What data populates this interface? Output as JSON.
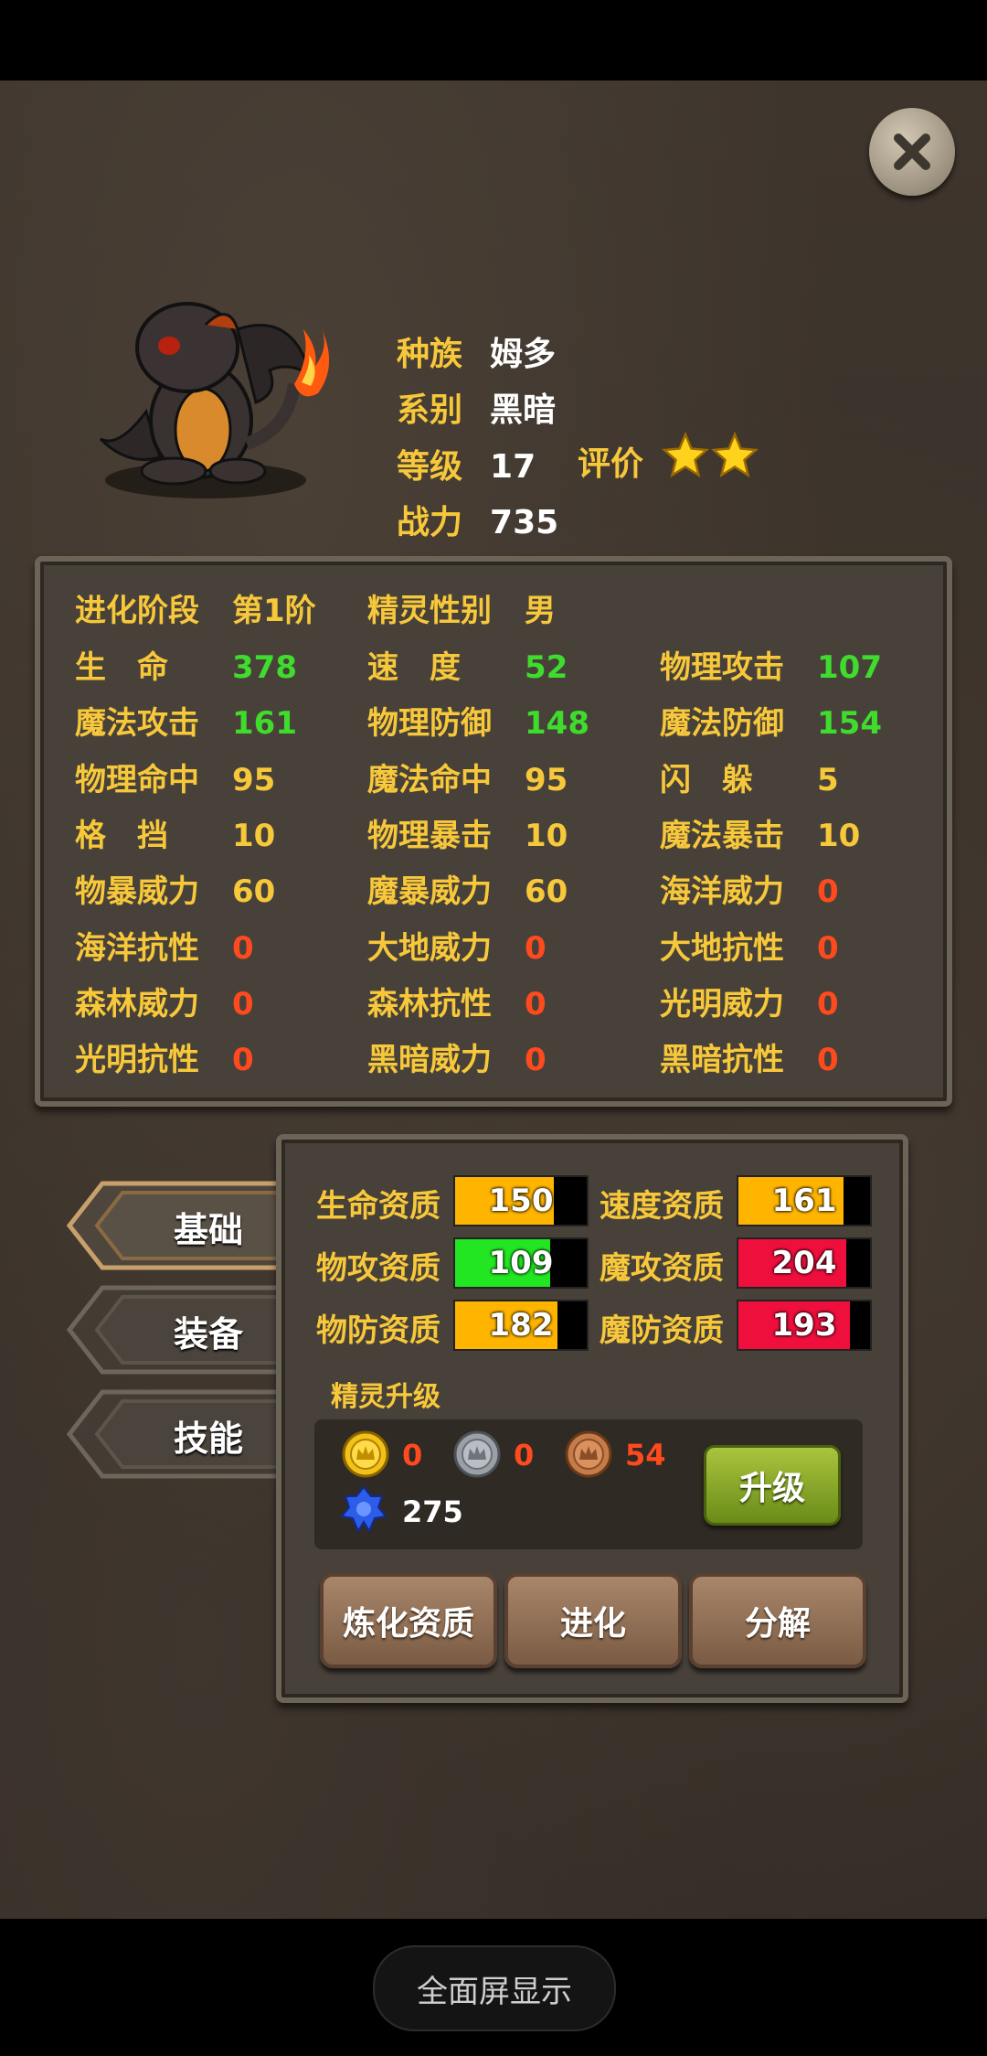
{
  "profile": {
    "race_label": "种族",
    "race": "姆多",
    "type_label": "系别",
    "type": "黑暗",
    "level_label": "等级",
    "level": "17",
    "power_label": "战力",
    "power": "735",
    "rating_label": "评价",
    "rating_stars": 2
  },
  "stats": {
    "header": [
      {
        "label": "进化阶段",
        "value": "第1阶",
        "color": "#f7c83a"
      },
      {
        "label": "精灵性别",
        "value": "男",
        "color": "#f7c83a"
      }
    ],
    "rows": [
      [
        {
          "label": "生　命",
          "value": "378",
          "color": "#3fdc2e"
        },
        {
          "label": "速　度",
          "value": "52",
          "color": "#3fdc2e"
        },
        {
          "label": "物理攻击",
          "value": "107",
          "color": "#3fdc2e"
        }
      ],
      [
        {
          "label": "魔法攻击",
          "value": "161",
          "color": "#3fdc2e"
        },
        {
          "label": "物理防御",
          "value": "148",
          "color": "#3fdc2e"
        },
        {
          "label": "魔法防御",
          "value": "154",
          "color": "#3fdc2e"
        }
      ],
      [
        {
          "label": "物理命中",
          "value": "95",
          "color": "#f7c83a"
        },
        {
          "label": "魔法命中",
          "value": "95",
          "color": "#f7c83a"
        },
        {
          "label": "闪　躲",
          "value": "5",
          "color": "#f7c83a"
        }
      ],
      [
        {
          "label": "格　挡",
          "value": "10",
          "color": "#f7c83a"
        },
        {
          "label": "物理暴击",
          "value": "10",
          "color": "#f7c83a"
        },
        {
          "label": "魔法暴击",
          "value": "10",
          "color": "#f7c83a"
        }
      ],
      [
        {
          "label": "物暴威力",
          "value": "60",
          "color": "#f7c83a"
        },
        {
          "label": "魔暴威力",
          "value": "60",
          "color": "#f7c83a"
        },
        {
          "label": "海洋威力",
          "value": "0",
          "color": "#ff4a1e"
        }
      ],
      [
        {
          "label": "海洋抗性",
          "value": "0",
          "color": "#ff4a1e"
        },
        {
          "label": "大地威力",
          "value": "0",
          "color": "#ff4a1e"
        },
        {
          "label": "大地抗性",
          "value": "0",
          "color": "#ff4a1e"
        }
      ],
      [
        {
          "label": "森林威力",
          "value": "0",
          "color": "#ff4a1e"
        },
        {
          "label": "森林抗性",
          "value": "0",
          "color": "#ff4a1e"
        },
        {
          "label": "光明威力",
          "value": "0",
          "color": "#ff4a1e"
        }
      ],
      [
        {
          "label": "光明抗性",
          "value": "0",
          "color": "#ff4a1e"
        },
        {
          "label": "黑暗威力",
          "value": "0",
          "color": "#ff4a1e"
        },
        {
          "label": "黑暗抗性",
          "value": "0",
          "color": "#ff4a1e"
        }
      ]
    ]
  },
  "tabs": [
    {
      "label": "基础",
      "active": true
    },
    {
      "label": "装备",
      "active": false
    },
    {
      "label": "技能",
      "active": false
    }
  ],
  "aptitudes": [
    {
      "label": "生命资质",
      "value": "150",
      "fill": 0.75,
      "color": "#ffb400"
    },
    {
      "label": "速度资质",
      "value": "161",
      "fill": 0.8,
      "color": "#ffb400"
    },
    {
      "label": "物攻资质",
      "value": "109",
      "fill": 0.72,
      "color": "#22e622"
    },
    {
      "label": "魔攻资质",
      "value": "204",
      "fill": 0.82,
      "color": "#ee0f3c"
    },
    {
      "label": "物防资质",
      "value": "182",
      "fill": 0.78,
      "color": "#ffb400"
    },
    {
      "label": "魔防资质",
      "value": "193",
      "fill": 0.85,
      "color": "#ee0f3c"
    }
  ],
  "upgrade": {
    "title": "精灵升级",
    "gold_coin": "0",
    "silver_coin": "0",
    "bronze_coin": "54",
    "crystal": "275",
    "upgrade_button": "升级"
  },
  "actions": {
    "refine": "炼化资质",
    "evolve": "进化",
    "decompose": "分解"
  },
  "system": {
    "fullscreen": "全面屏显示"
  }
}
